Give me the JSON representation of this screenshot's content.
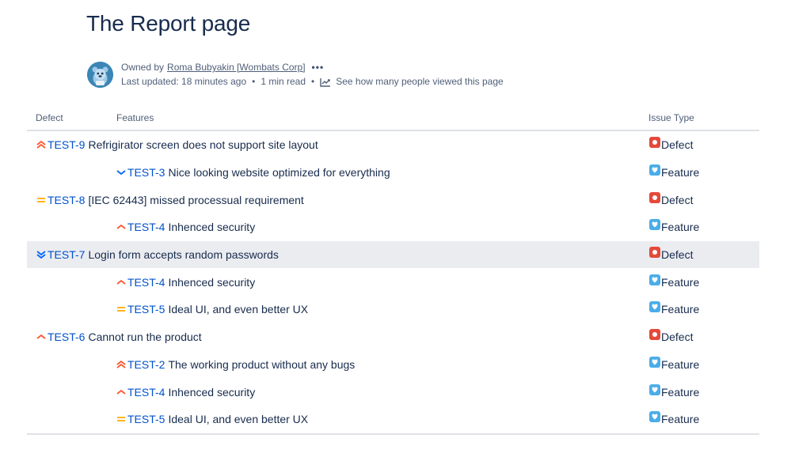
{
  "page": {
    "title": "The Report page"
  },
  "byline": {
    "owned_by_label": "Owned by",
    "owner": "Roma Bubyakin [Wombats Corp]",
    "more": "•••",
    "last_updated": "Last updated: 18 minutes ago",
    "separator": "•",
    "read_time": "1 min read",
    "views_link": "See how many people viewed this page"
  },
  "table": {
    "headers": {
      "defect": "Defect",
      "features": "Features",
      "issue_type": "Issue Type"
    },
    "rows": [
      {
        "key": "TEST-9",
        "summary": "Refrigirator screen does not support site layout",
        "priority": "highest",
        "type": "Defect"
      },
      {
        "key": "TEST-3",
        "summary": "Nice looking website optimized for everything",
        "priority": "low",
        "type": "Feature"
      },
      {
        "key": "TEST-8",
        "summary": "[IEC 62443] missed processual requirement",
        "priority": "medium",
        "type": "Defect"
      },
      {
        "key": "TEST-4",
        "summary": "Inhenced security",
        "priority": "high",
        "type": "Feature"
      },
      {
        "key": "TEST-7",
        "summary": "Login form accepts random passwords",
        "priority": "lowest",
        "type": "Defect"
      },
      {
        "key": "TEST-4",
        "summary": "Inhenced security",
        "priority": "high",
        "type": "Feature"
      },
      {
        "key": "TEST-5",
        "summary": "Ideal UI, and even better UX",
        "priority": "medium",
        "type": "Feature"
      },
      {
        "key": "TEST-6",
        "summary": "Cannot run the product",
        "priority": "high",
        "type": "Defect"
      },
      {
        "key": "TEST-2",
        "summary": "The working product without any bugs",
        "priority": "highest",
        "type": "Feature"
      },
      {
        "key": "TEST-4",
        "summary": "Inhenced security",
        "priority": "high",
        "type": "Feature"
      },
      {
        "key": "TEST-5",
        "summary": "Ideal UI, and even better UX",
        "priority": "medium",
        "type": "Feature"
      }
    ]
  },
  "colors": {
    "defect": "#e5493a",
    "feature": "#4bade8",
    "link": "#0052cc",
    "priority_high": "#ff5630",
    "priority_medium": "#ffab00",
    "priority_low": "#0065ff"
  }
}
